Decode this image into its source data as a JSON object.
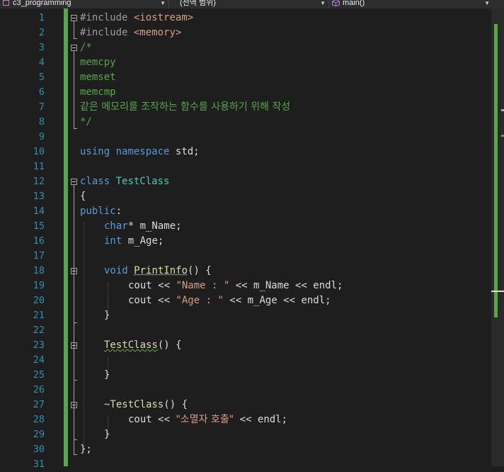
{
  "navigation_bar": {
    "project": "c3_programming",
    "scope": "(전역 범위)",
    "member": "main()"
  },
  "code": {
    "line_numbers": [
      "1",
      "2",
      "3",
      "4",
      "5",
      "6",
      "7",
      "8",
      "9",
      "10",
      "11",
      "12",
      "13",
      "14",
      "15",
      "16",
      "17",
      "18",
      "19",
      "20",
      "21",
      "22",
      "23",
      "24",
      "25",
      "26",
      "27",
      "28",
      "29",
      "30",
      "31"
    ],
    "line_1": {
      "directive": "#include",
      "header": "<iostream>"
    },
    "line_2": {
      "directive": "#include",
      "header": "<memory>"
    },
    "line_3": "/*",
    "line_4": "memcpy",
    "line_5": "memset",
    "line_6": "memcmp",
    "line_7": "같은 메모리를 조작하는 함수를 사용하기 위해 작성",
    "line_8": "*/",
    "line_10": {
      "kw1": "using",
      "kw2": "namespace",
      "id": "std;"
    },
    "line_12": {
      "kw": "class",
      "name": "TestClass"
    },
    "line_13": "{",
    "line_14": {
      "kw": "public",
      "punct": ":"
    },
    "line_15": {
      "kw": "char",
      "rest": "* m_Name;"
    },
    "line_16": {
      "kw": "int",
      "rest": "m_Age;"
    },
    "line_18": {
      "kw": "void",
      "name": "PrintInfo",
      "rest": "() {"
    },
    "line_19": {
      "pre": "cout << ",
      "str": "\"Name : \"",
      "post": " << m_Name << endl;"
    },
    "line_20": {
      "pre": "cout << ",
      "str": "\"Age : \"",
      "post": " << m_Age << endl;"
    },
    "line_21": "}",
    "line_23": {
      "name": "TestClass",
      "rest": "() {"
    },
    "line_25": "}",
    "line_27": {
      "name": "~TestClass",
      "rest": "() {"
    },
    "line_28": {
      "pre": "cout << ",
      "str": "\"소멸자 호출\"",
      "post": " << endl;"
    },
    "line_29": "}",
    "line_30": "};"
  },
  "colors": {
    "keyword": "#569cd6",
    "comment": "#57a64a",
    "string": "#d69d85",
    "type": "#4ec9b0",
    "line_number": "#2b91af",
    "change_bar": "#57a64a"
  }
}
